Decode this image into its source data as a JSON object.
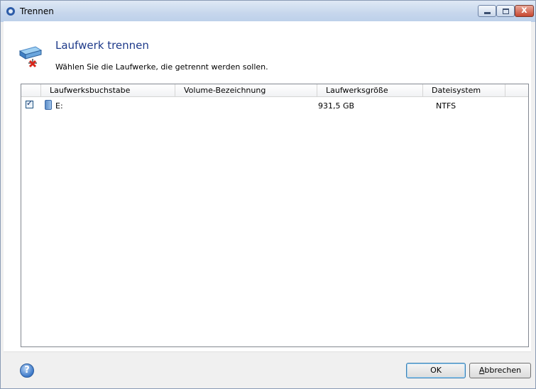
{
  "window": {
    "title": "Trennen",
    "close_glyph": "x"
  },
  "header": {
    "title": "Laufwerk trennen",
    "subtitle": "Wählen Sie die Laufwerke, die getrennt werden sollen.",
    "icon": "drive-disconnect-icon"
  },
  "table": {
    "columns": [
      "Laufwerksbuchstabe",
      "Volume-Bezeichnung",
      "Laufwerksgröße",
      "Dateisystem"
    ],
    "rows": [
      {
        "checked": true,
        "letter": "E:",
        "volume_label": "",
        "size": "931,5 GB",
        "filesystem": "NTFS"
      }
    ]
  },
  "footer": {
    "help_glyph": "?",
    "ok_label": "OK",
    "cancel_accel": "A",
    "cancel_rest": "bbrechen"
  }
}
